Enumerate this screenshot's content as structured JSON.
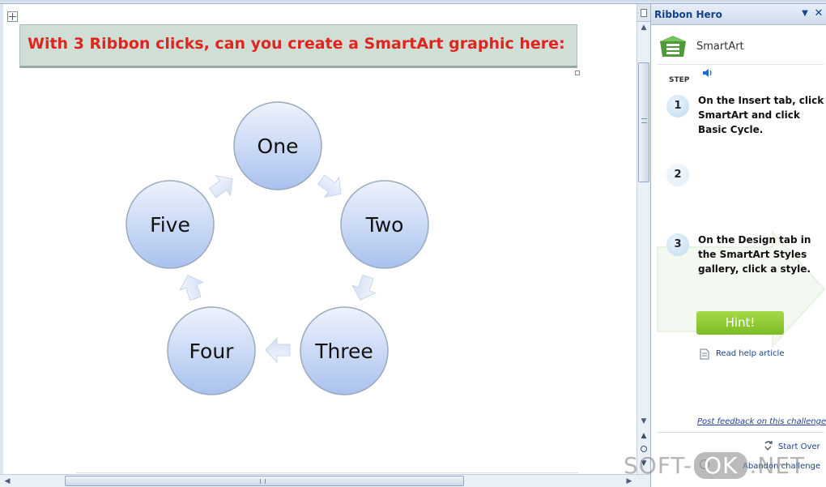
{
  "document": {
    "title": "With 3 Ribbon clicks, can you create a SmartArt graphic here:",
    "cycle_nodes": [
      "One",
      "Two",
      "Three",
      "Four",
      "Five"
    ]
  },
  "task_pane": {
    "title": "Ribbon Hero",
    "topic": "SmartArt",
    "step_label": "STEP",
    "steps": [
      {
        "number": "1",
        "text": "On the Insert tab, click SmartArt and click Basic Cycle."
      },
      {
        "number": "2",
        "text": ""
      },
      {
        "number": "3",
        "text": "On the Design tab in the SmartArt Styles gallery, click a style."
      }
    ],
    "hint_button": "Hint!",
    "help_link": "Read help article",
    "feedback_link": "Post feedback on this challenge",
    "start_over": "Start Over",
    "abandon": "Abandon challenge"
  },
  "watermark": {
    "left": "SOFT-",
    "mid": "OK",
    "right": ".NET"
  },
  "colors": {
    "title_text": "#e1241e",
    "title_box": "#cfdfd6",
    "node_fill_top": "#eef3fd",
    "node_fill_bottom": "#a9c2ee",
    "hint_green": "#8cc63f",
    "pane_title": "#15428b"
  },
  "icons": [
    "move-handle-icon",
    "split-icon",
    "smartart-icon",
    "speaker-icon",
    "document-icon",
    "start-over-icon",
    "abandon-icon",
    "dropdown-icon",
    "close-icon"
  ]
}
